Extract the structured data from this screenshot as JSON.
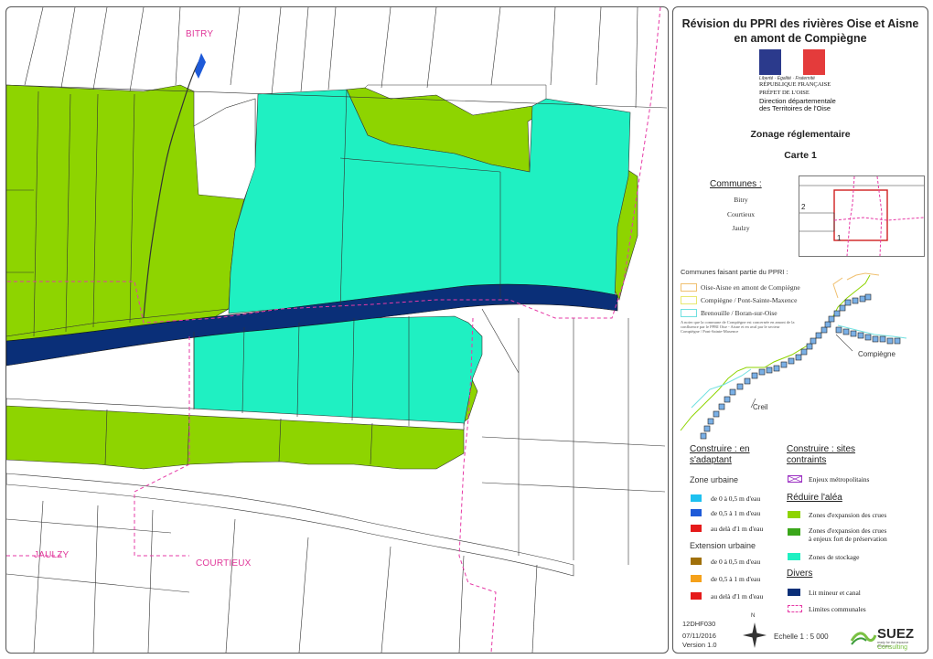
{
  "map": {
    "places": {
      "bitry": "BITRY",
      "jaulzy": "JAULZY",
      "courtieux": "COURTIEUX"
    },
    "colors": {
      "green": "#8ed400",
      "cyan": "#1ff0c2",
      "navy": "#0a2f78",
      "pink": "#e63aa6"
    }
  },
  "panel": {
    "title_line1": "Révision du PPRI des rivières Oise et Aisne",
    "title_line2": "en amont de Compiègne",
    "logo": {
      "motto": "Liberté · Égalité · Fraternité",
      "republique": "RÉPUBLIQUE FRANÇAISE",
      "prefet": "PRÉFET DE L'OISE",
      "ddt_line1": "Direction départementale",
      "ddt_line2": "des Territoires de l'Oise"
    },
    "zonage": "Zonage réglementaire",
    "carte": "Carte 1",
    "communes_heading": "Communes :",
    "communes": [
      "Bitry",
      "Courtieux",
      "Jaulzy"
    ],
    "inset_labels": [
      "2",
      "1"
    ],
    "ppri_heading": "Communes faisant partie du PPRI :",
    "ppri_items": [
      {
        "label": "Oise-Aisne en amont de Compiègne",
        "color": "#f0c070"
      },
      {
        "label": "Compiègne / Pont-Sainte-Maxence",
        "color": "#e8e870"
      },
      {
        "label": "Brenouille / Boran-sur-Oise",
        "color": "#70e0e0"
      }
    ],
    "ppri_note": "A noter que la commune de Compiègne est concernée en amont de la confluence par le PPRI Oise - Aisne et en aval par le secteur Compiègne / Pont-Sainte-Maxence",
    "city_compiegne": "Compiègne",
    "city_creil": "Creil"
  },
  "legend": {
    "construire_adaptant_line1": "Construire : en",
    "construire_adaptant_line2": "s'adaptant",
    "construire_sites_line1": "Construire : sites",
    "construire_sites_line2": "contraints",
    "zone_urbaine": "Zone urbaine",
    "zu_items": [
      {
        "label": "de 0 à 0,5 m d'eau",
        "color": "#1ec1f0"
      },
      {
        "label": "de 0,5 à 1 m d'eau",
        "color": "#1e5ad8"
      },
      {
        "label": "au delà d'1 m d'eau",
        "color": "#e51a1a"
      }
    ],
    "extension_urbaine": "Extension urbaine",
    "eu_items": [
      {
        "label": "de 0 à 0,5 m d'eau",
        "color": "#a0700a"
      },
      {
        "label": "de 0,5 à 1 m d'eau",
        "color": "#f5a11a"
      },
      {
        "label": "au delà d'1 m d'eau",
        "color": "#e51a1a"
      }
    ],
    "enjeux": {
      "label": "Enjeux métropolitains",
      "color": "#9b2fc2"
    },
    "reduire_alea": "Réduire l'aléa",
    "zones_expansion": {
      "label": "Zones d'expansion des crues",
      "color": "#8ed400"
    },
    "zones_expansion_fort": {
      "label_line1": "Zones d'expansion des crues",
      "label_line2": "à enjeux fort de préservation",
      "color": "#3aa61a"
    },
    "zones_stockage": {
      "label": "Zones de stockage",
      "color": "#1ff0c2"
    },
    "divers": "Divers",
    "lit_mineur": {
      "label": "Lit mineur et canal",
      "color": "#0a2f78"
    },
    "limites": {
      "label": "Limites communales",
      "color": "#e63aa6"
    }
  },
  "footer": {
    "code": "12DHF030",
    "date": "07/11/2016",
    "version": "Version 1.0",
    "north": "N",
    "echelle": "Echelle  1 : 5 000",
    "brand": "SUEZ",
    "brand_sub": "Consulting",
    "brand_tag": "ready for the resource revolution"
  }
}
